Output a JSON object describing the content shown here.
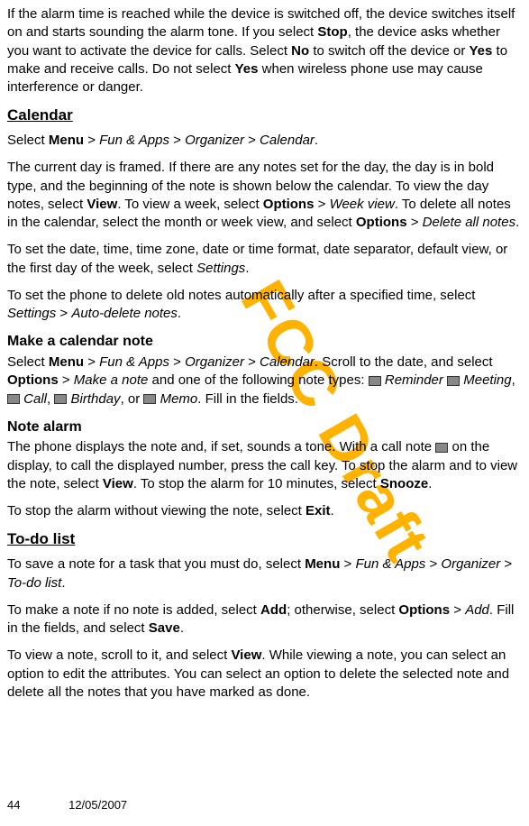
{
  "watermark": "FCC Draft",
  "para1": {
    "t1": "If the alarm time is reached while the device is switched off, the device switches itself on and starts sounding the alarm tone. If you select ",
    "b1": "Stop",
    "t2": ", the device asks whether you want to activate the device for calls. Select ",
    "b2": "No",
    "t3": " to switch off the device or ",
    "b3": "Yes",
    "t4": " to make and receive calls. Do not select ",
    "b4": "Yes",
    "t5": " when wireless phone use may cause interference or danger."
  },
  "h_calendar": "Calendar",
  "para2": {
    "t1": "Select ",
    "b1": "Menu",
    "t2": " > ",
    "i1": "Fun & Apps",
    "t3": " > ",
    "i2": "Organizer",
    "t4": " > ",
    "i3": "Calendar",
    "t5": "."
  },
  "para3": {
    "t1": "The current day is framed. If there are any notes set for the day, the day is in bold type, and the beginning of the note is shown below the calendar. To view the day notes, select ",
    "b1": "View",
    "t2": ". To view a week, select ",
    "b2": "Options",
    "t3": " > ",
    "i1": "Week view",
    "t4": ". To delete all notes in the calendar, select the month or week view, and select ",
    "b3": "Options",
    "t5": " > ",
    "i2": "Delete all notes",
    "t6": "."
  },
  "para4": {
    "t1": "To set the date, time, time zone, date or time format, date separator, default view, or the first day of the week, select ",
    "i1": "Settings",
    "t2": "."
  },
  "para5": {
    "t1": "To set the phone to delete old notes automatically after a specified time, select ",
    "i1": "Settings",
    "t2": " > ",
    "i2": "Auto-delete notes",
    "t3": "."
  },
  "h_make_note": "Make a calendar note",
  "para6": {
    "t1": "Select ",
    "b1": "Menu",
    "t2": " > ",
    "i1": "Fun & Apps",
    "t3": " > ",
    "i2": "Organizer",
    "t4": " > ",
    "i3": "Calendar",
    "t5": ". Scroll to the date, and select ",
    "b2": "Options",
    "t6": " > ",
    "i4": "Make a note",
    "t7": " and one of the following note types: ",
    "i5": " Reminder",
    "t8": " ",
    "i6": " Meeting",
    "t9": ", ",
    "i7": " Call",
    "t10": ", ",
    "i8": " Birthday",
    "t11": ", or ",
    "i9": " Memo",
    "t12": ". Fill in the fields."
  },
  "h_note_alarm": "Note alarm",
  "para7": {
    "t1": "The phone displays the note and, if set, sounds a tone. With a call note ",
    "t2": " on the display, to call the displayed number, press the call key. To stop the alarm and to view the note, select ",
    "b1": "View",
    "t3": ". To stop the alarm for 10 minutes, select ",
    "b2": "Snooze",
    "t4": "."
  },
  "para8": {
    "t1": "To stop the alarm without viewing the note, select ",
    "b1": "Exit",
    "t2": "."
  },
  "h_todo": "To-do list",
  "para9": {
    "t1": "To save a note for a task that you must do, select ",
    "b1": "Menu",
    "t2": " > ",
    "i1": "Fun & Apps",
    "t3": " > ",
    "i2": "Organizer",
    "t4": " > ",
    "i3": "To-do list",
    "t5": "."
  },
  "para10": {
    "t1": "To make a note if no note is added, select ",
    "b1": "Add",
    "t2": "; otherwise, select ",
    "b2": "Options",
    "t3": " > ",
    "i1": "Add",
    "t4": ". Fill in the fields, and select ",
    "b3": "Save",
    "t5": "."
  },
  "para11": {
    "t1": "To view a note, scroll to it, and select ",
    "b1": "View",
    "t2": ". While viewing a note, you can select an option to edit the attributes. You can select an option to delete the selected note and delete all the notes that you have marked as done."
  },
  "footer": {
    "page": "44",
    "date": "12/05/2007"
  }
}
